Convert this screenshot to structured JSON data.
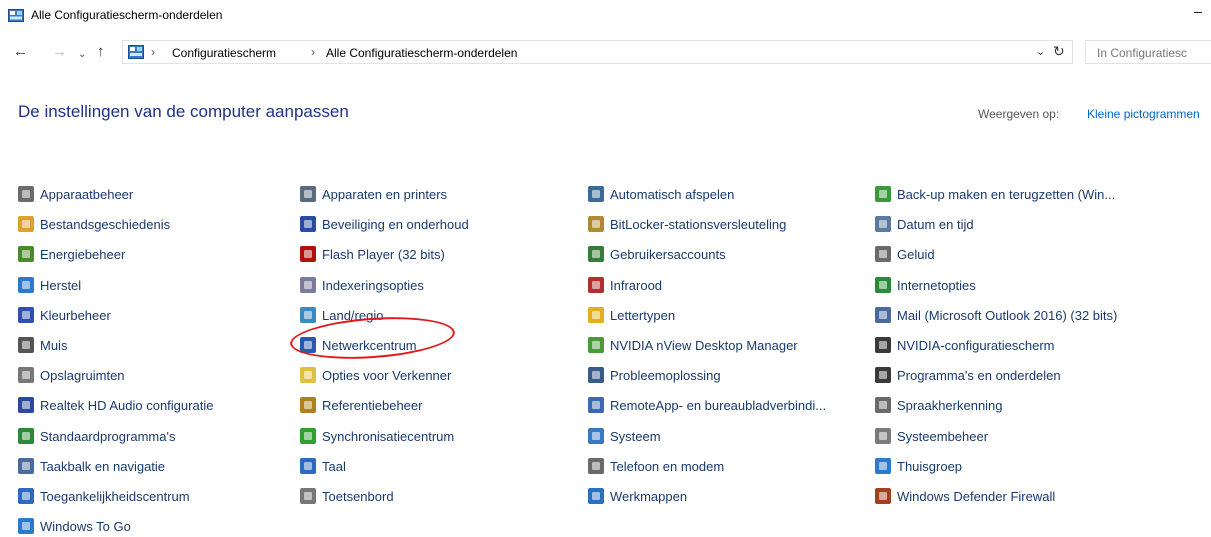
{
  "window": {
    "title": "Alle Configuratiescherm-onderdelen",
    "minimize_glyph": "–"
  },
  "nav": {
    "back_glyph": "←",
    "forward_glyph": "→",
    "recent_glyph": "⌄",
    "up_glyph": "↑",
    "separator": "›",
    "breadcrumbs": [
      "Configuratiescherm",
      "Alle Configuratiescherm-onderdelen"
    ],
    "dropdown_glyph": "⌄",
    "refresh_glyph": "↻",
    "search_placeholder": "In Configuratiesc"
  },
  "header": {
    "title": "De instellingen van de computer aanpassen",
    "view_label": "Weergeven op:",
    "view_value": "Kleine pictogrammen"
  },
  "items": [
    {
      "label": "Apparaatbeheer",
      "icon": "device-manager-icon",
      "color": "#6b6b6b"
    },
    {
      "label": "Bestandsgeschiedenis",
      "icon": "file-history-icon",
      "color": "#e0a030"
    },
    {
      "label": "Energiebeheer",
      "icon": "power-options-icon",
      "color": "#4a8a2a"
    },
    {
      "label": "Herstel",
      "icon": "recovery-icon",
      "color": "#2a7ad0"
    },
    {
      "label": "Kleurbeheer",
      "icon": "color-management-icon",
      "color": "#3050b0"
    },
    {
      "label": "Muis",
      "icon": "mouse-icon",
      "color": "#555555"
    },
    {
      "label": "Opslagruimten",
      "icon": "storage-spaces-icon",
      "color": "#777777"
    },
    {
      "label": "Realtek HD Audio configuratie",
      "icon": "realtek-audio-icon",
      "color": "#2a4aa0"
    },
    {
      "label": "Standaardprogramma's",
      "icon": "default-programs-icon",
      "color": "#2a8a3a"
    },
    {
      "label": "Taakbalk en navigatie",
      "icon": "taskbar-icon",
      "color": "#4a6aa0"
    },
    {
      "label": "Toegankelijkheidscentrum",
      "icon": "ease-of-access-icon",
      "color": "#2a6ac0"
    },
    {
      "label": "Windows To Go",
      "icon": "windows-to-go-icon",
      "color": "#2a7ad0"
    },
    {
      "label": "Apparaten en printers",
      "icon": "devices-printers-icon",
      "color": "#5a6a80"
    },
    {
      "label": "Beveiliging en onderhoud",
      "icon": "security-maintenance-icon",
      "color": "#2a4aa0"
    },
    {
      "label": "Flash Player (32 bits)",
      "icon": "flash-player-icon",
      "color": "#b01010"
    },
    {
      "label": "Indexeringsopties",
      "icon": "indexing-options-icon",
      "color": "#7a7a9a"
    },
    {
      "label": "Land/regio",
      "icon": "region-icon",
      "color": "#3a8ac0"
    },
    {
      "label": "Netwerkcentrum",
      "icon": "network-center-icon",
      "color": "#2a5ab0"
    },
    {
      "label": "Opties voor Verkenner",
      "icon": "explorer-options-icon",
      "color": "#e0c040"
    },
    {
      "label": "Referentiebeheer",
      "icon": "credential-manager-icon",
      "color": "#b08020"
    },
    {
      "label": "Synchronisatiecentrum",
      "icon": "sync-center-icon",
      "color": "#30a030"
    },
    {
      "label": "Taal",
      "icon": "language-icon",
      "color": "#2a6ac0"
    },
    {
      "label": "Toetsenbord",
      "icon": "keyboard-icon",
      "color": "#777777"
    },
    {
      "label": "Automatisch afspelen",
      "icon": "autoplay-icon",
      "color": "#3a6a9a"
    },
    {
      "label": "BitLocker-stationsversleuteling",
      "icon": "bitlocker-icon",
      "color": "#b08a30"
    },
    {
      "label": "Gebruikersaccounts",
      "icon": "user-accounts-icon",
      "color": "#3a7a3a"
    },
    {
      "label": "Infrarood",
      "icon": "infrared-icon",
      "color": "#b03030"
    },
    {
      "label": "Lettertypen",
      "icon": "fonts-icon",
      "color": "#e0b020"
    },
    {
      "label": "NVIDIA nView Desktop Manager",
      "icon": "nvidia-nview-icon",
      "color": "#4a9a3a"
    },
    {
      "label": "Probleemoplossing",
      "icon": "troubleshooting-icon",
      "color": "#3a5a8a"
    },
    {
      "label": "RemoteApp- en bureaubladverbindi...",
      "icon": "remoteapp-icon",
      "color": "#3a6ab0"
    },
    {
      "label": "Systeem",
      "icon": "system-icon",
      "color": "#3a7ac0"
    },
    {
      "label": "Telefoon en modem",
      "icon": "phone-modem-icon",
      "color": "#6a6a6a"
    },
    {
      "label": "Werkmappen",
      "icon": "work-folders-icon",
      "color": "#2a70c0"
    },
    {
      "label": "Back-up maken en terugzetten (Win...",
      "icon": "backup-restore-icon",
      "color": "#3a9a3a"
    },
    {
      "label": "Datum en tijd",
      "icon": "date-time-icon",
      "color": "#5a7aa0"
    },
    {
      "label": "Geluid",
      "icon": "sound-icon",
      "color": "#6a6a6a"
    },
    {
      "label": "Internetopties",
      "icon": "internet-options-icon",
      "color": "#2a8a3a"
    },
    {
      "label": "Mail (Microsoft Outlook 2016) (32 bits)",
      "icon": "mail-icon",
      "color": "#4a6a9a"
    },
    {
      "label": "NVIDIA-configuratiescherm",
      "icon": "nvidia-control-panel-icon",
      "color": "#3a3a3a"
    },
    {
      "label": "Programma's en onderdelen",
      "icon": "programs-features-icon",
      "color": "#3a3a3a"
    },
    {
      "label": "Spraakherkenning",
      "icon": "speech-recognition-icon",
      "color": "#6a6a6a"
    },
    {
      "label": "Systeembeheer",
      "icon": "administrative-tools-icon",
      "color": "#7a7a7a"
    },
    {
      "label": "Thuisgroep",
      "icon": "homegroup-icon",
      "color": "#2a7ad0"
    },
    {
      "label": "Windows Defender Firewall",
      "icon": "firewall-icon",
      "color": "#a04020"
    }
  ]
}
